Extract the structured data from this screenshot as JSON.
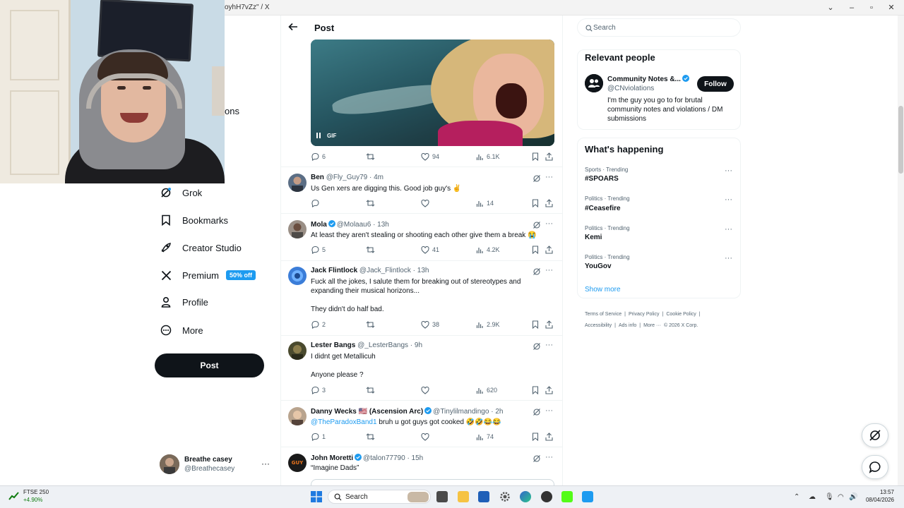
{
  "window": {
    "title": "oyhH7vZz\" / X"
  },
  "webcam": {
    "partial_nav_text": "ons"
  },
  "nav": {
    "items": [
      {
        "label": "Grok",
        "icon": "grok-icon"
      },
      {
        "label": "Bookmarks",
        "icon": "bookmark-icon"
      },
      {
        "label": "Creator Studio",
        "icon": "rocket-icon"
      },
      {
        "label": "Premium",
        "icon": "x-logo-icon",
        "badge": "50% off"
      },
      {
        "label": "Profile",
        "icon": "person-icon"
      },
      {
        "label": "More",
        "icon": "more-circle-icon"
      }
    ],
    "post_button": "Post",
    "account": {
      "name": "Breathe casey",
      "handle": "@Breathecasey"
    }
  },
  "main": {
    "header_title": "Post",
    "gif_label": "GIF",
    "main_post_stats": {
      "replies": "6",
      "likes": "94",
      "views": "6.1K"
    },
    "replies": [
      {
        "name": "Ben",
        "handle": "@Fly_Guy79",
        "time": "· 4m",
        "verified": false,
        "text": "Us Gen xers are digging this. Good job guy's ✌",
        "replies": "",
        "reposts": "",
        "likes": "",
        "views": "14"
      },
      {
        "name": "Mola",
        "handle": "@Molaau6",
        "time": "· 13h",
        "verified": true,
        "text": "At least they aren't stealing or shooting each other give them a break 😭",
        "replies": "5",
        "reposts": "",
        "likes": "41",
        "views": "4.2K"
      },
      {
        "name": "Jack Flintlock",
        "handle": "@Jack_Flintlock",
        "time": "· 13h",
        "verified": false,
        "text": "Fuck all the jokes, I salute them for breaking out of stereotypes and expanding their musical horizons...",
        "text2": "They didn't do half bad.",
        "replies": "2",
        "reposts": "",
        "likes": "38",
        "views": "2.9K"
      },
      {
        "name": "Lester Bangs",
        "handle": "@_LesterBangs",
        "time": "· 9h",
        "verified": false,
        "text": "I didnt get Metallicuh",
        "text2": "Anyone please ?",
        "replies": "3",
        "reposts": "",
        "likes": "",
        "views": "620"
      },
      {
        "name": "Danny Wecks 🇺🇸 (Ascension Arc)",
        "handle": "@Tinylilmandingo",
        "time": "· 2h",
        "verified": true,
        "mention": "@TheParadoxBand1",
        "text": " bruh u got guys got cooked 🤣🤣😂😂",
        "replies": "1",
        "reposts": "",
        "likes": "",
        "views": "74"
      },
      {
        "name": "John Moretti",
        "handle": "@talon77790",
        "time": "· 15h",
        "verified": true,
        "text": "“Imagine Dads”",
        "avatar_text": "GUY"
      }
    ]
  },
  "right": {
    "search_placeholder": "Search",
    "relevant_title": "Relevant people",
    "person": {
      "name": "Community Notes &...",
      "handle": "@CNviolations",
      "bio": "I'm the guy you go to for brutal community notes and violations / DM submissions",
      "follow": "Follow"
    },
    "happening_title": "What's happening",
    "trends": [
      {
        "category": "Sports · Trending",
        "name": "#SPOARS"
      },
      {
        "category": "Politics · Trending",
        "name": "#Ceasefire"
      },
      {
        "category": "Politics · Trending",
        "name": "Kemi"
      },
      {
        "category": "Politics · Trending",
        "name": "YouGov"
      }
    ],
    "show_more": "Show more",
    "footer_line1": [
      "Terms of Service",
      "|",
      "Privacy Policy",
      "|",
      "Cookie Policy",
      "|"
    ],
    "footer_line2": [
      "Accessibility",
      "|",
      "Ads info",
      "|",
      "More ···",
      "© 2026 X Corp."
    ]
  },
  "taskbar": {
    "ftse_name": "FTSE 250",
    "ftse_change": "+4.90%",
    "search_placeholder": "Search",
    "time": "13:57",
    "date": "08/04/2026"
  },
  "colors": {
    "accent": "#1d9bf0",
    "text": "#0f1419",
    "muted": "#536471"
  }
}
